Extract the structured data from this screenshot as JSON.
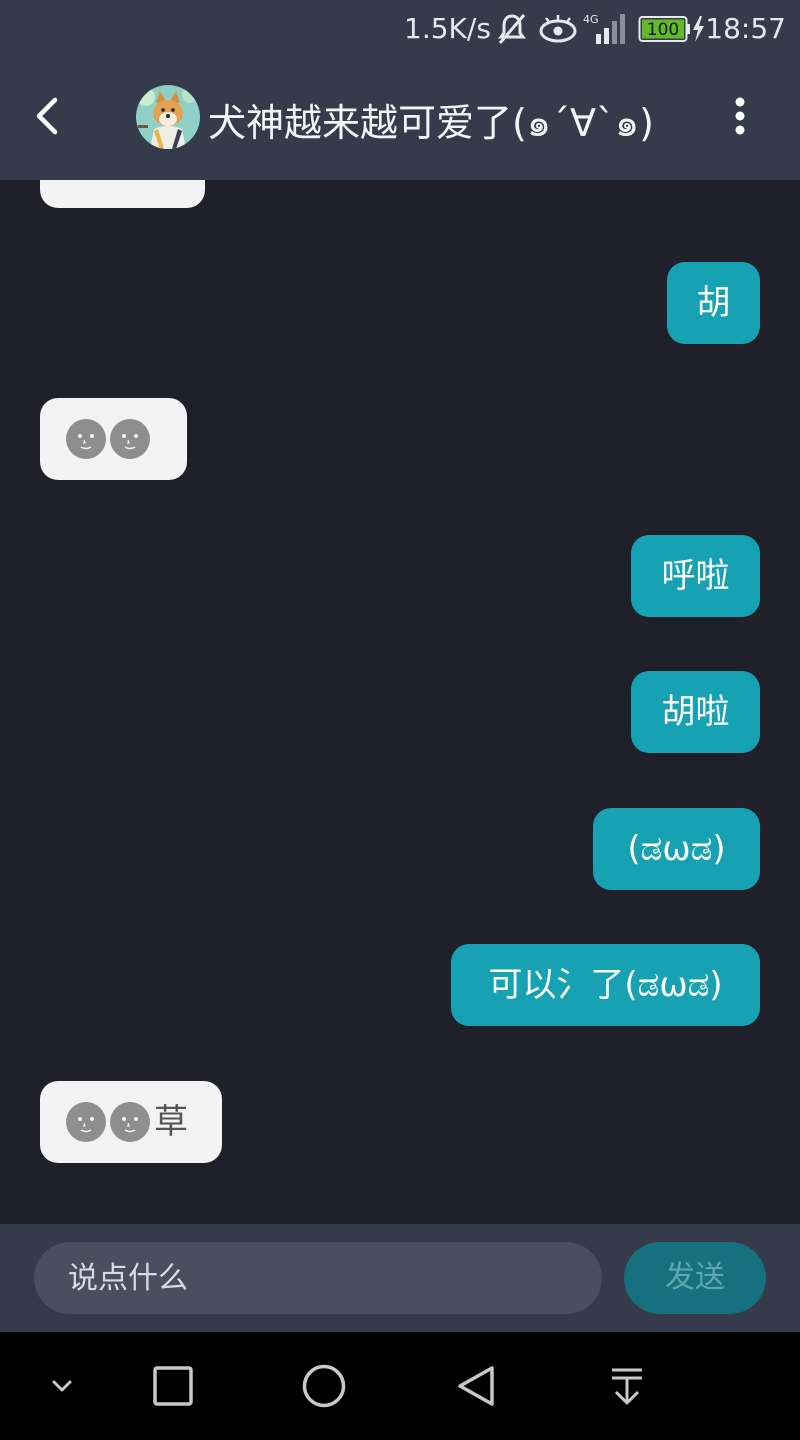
{
  "status_bar": {
    "net_speed": "1.5K/s",
    "network": "4G",
    "battery": "100",
    "time": "18:57"
  },
  "header": {
    "title": "犬神越来越可爱了(๑´∀`๑)",
    "icons": [
      "back-arrow-icon",
      "avatar",
      "more-vertical-icon"
    ]
  },
  "messages": [
    {
      "side": "in",
      "text": "",
      "emoji_count": 0,
      "partial": true
    },
    {
      "side": "out",
      "text": "胡"
    },
    {
      "side": "in",
      "text": "",
      "emoji_count": 2
    },
    {
      "side": "out",
      "text": "呼啦"
    },
    {
      "side": "out",
      "text": "胡啦"
    },
    {
      "side": "out",
      "text": "(ಡωಡ)"
    },
    {
      "side": "out",
      "text": "可以氵了(ಡωಡ)"
    },
    {
      "side": "in",
      "text": "草",
      "emoji_count": 2
    }
  ],
  "input": {
    "placeholder": "说点什么",
    "send_label": "发送"
  },
  "colors": {
    "header_bg": "#363b4b",
    "chat_bg": "#1f2029",
    "outgoing_bubble": "#17a2b3",
    "incoming_bubble": "#f3f3f3",
    "send_button": "#17707e"
  }
}
